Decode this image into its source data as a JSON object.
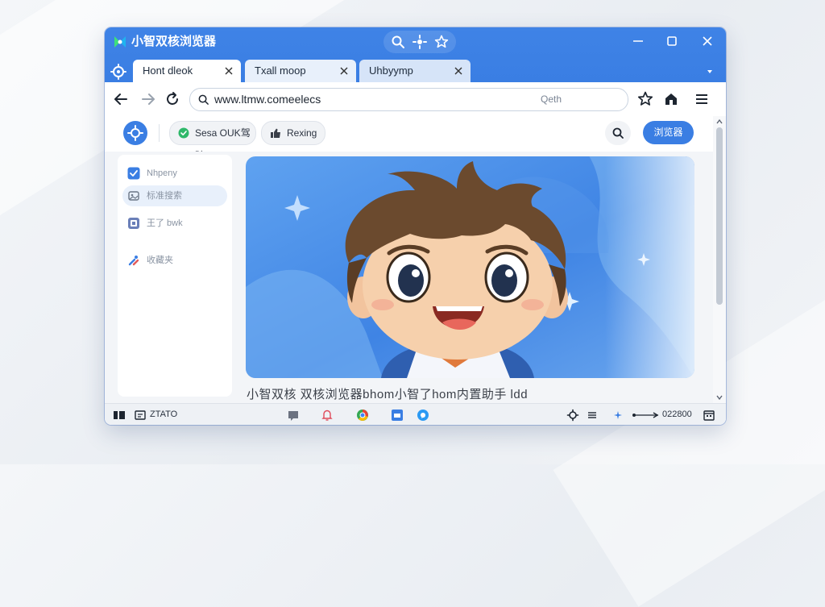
{
  "app": {
    "title": "小智双核浏览器"
  },
  "tabs": [
    {
      "label": "Hont dleok",
      "active": true
    },
    {
      "label": "Txall moop",
      "active": false
    },
    {
      "label": "Uhbyymp",
      "active": false
    }
  ],
  "address": {
    "url": "www.ltmw.comeelecs",
    "hint": "Qeth"
  },
  "toolbar": {
    "chip1": "Sesa OUK驾驶",
    "chip2": "Rexing",
    "primary": "浏览器"
  },
  "sidebar": {
    "items": [
      {
        "label": "Nhpeny"
      },
      {
        "label": "标准搜索"
      },
      {
        "label": "王了 bwk"
      },
      {
        "label": "收藏夹"
      }
    ]
  },
  "main": {
    "caption": "小智双核 双核浏览器bhom小智了hom内置助手 ldd"
  },
  "statusbar": {
    "left": "ZTATO",
    "right": "022800"
  },
  "colors": {
    "accent": "#3a7ee3",
    "hero_bg": "#4a90e8",
    "hair": "#6b4a2e"
  }
}
